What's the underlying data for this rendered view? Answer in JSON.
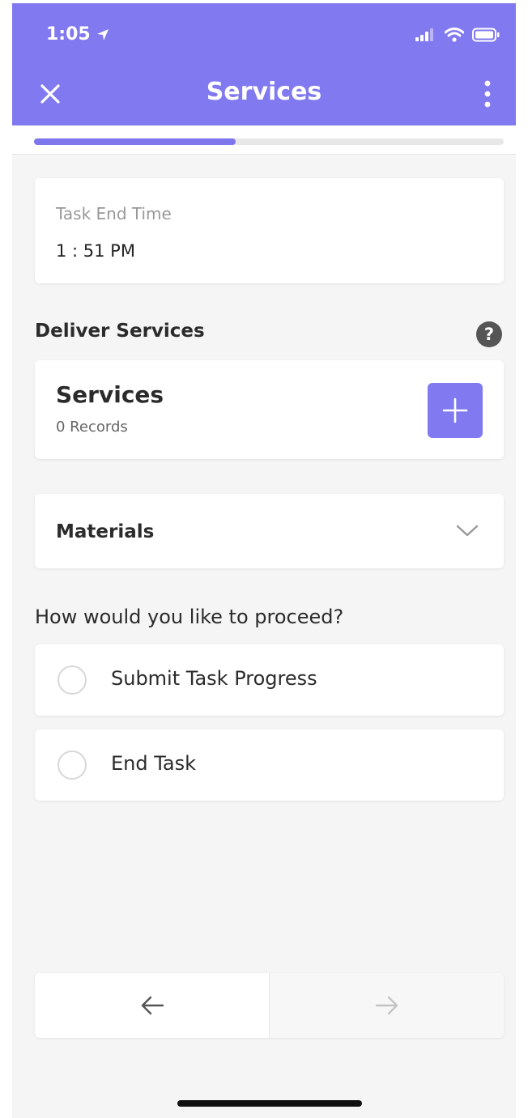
{
  "status_bar": {
    "time": "1:05"
  },
  "header": {
    "title": "Services"
  },
  "progress": {
    "fraction": 0.43
  },
  "task_end_time": {
    "label": "Task End Time",
    "value": "1 : 51 PM"
  },
  "deliver_services": {
    "heading": "Deliver Services",
    "card": {
      "title": "Services",
      "count": "0 Records"
    }
  },
  "materials": {
    "label": "Materials"
  },
  "proceed": {
    "question": "How would you like to proceed?",
    "options": [
      {
        "label": "Submit Task Progress"
      },
      {
        "label": "End Task"
      }
    ]
  },
  "colors": {
    "accent": "#8179ef",
    "background": "#f5f5f5"
  },
  "icons": {
    "close": "close-icon",
    "more": "more-vertical-icon",
    "help": "question-circle-icon",
    "add": "plus-icon",
    "expand": "chevron-down-icon",
    "back": "arrow-left-icon",
    "next": "arrow-right-icon"
  }
}
